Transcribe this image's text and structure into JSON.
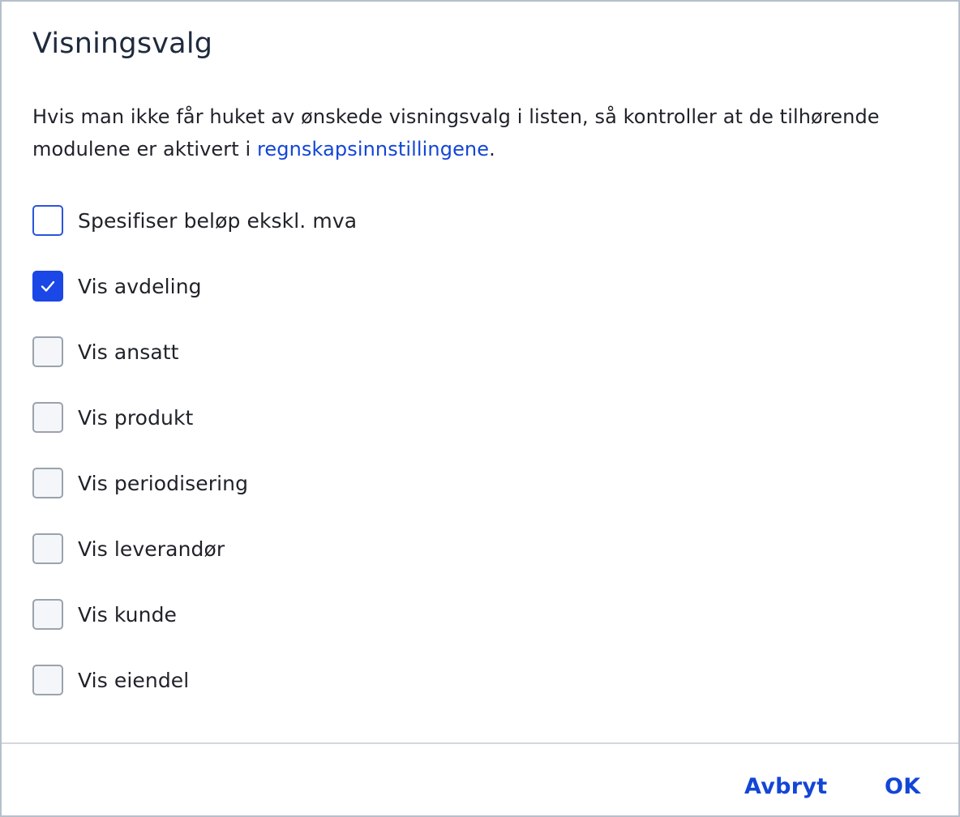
{
  "dialog": {
    "title": "Visningsvalg",
    "intro_text": "Hvis man ikke får huket av ønskede visningsvalg i listen, så kontroller at de tilhørende modulene er aktivert i ",
    "intro_link": "regnskapsinnstillingene",
    "intro_end": ".",
    "options": [
      {
        "label": "Spesifiser beløp ekskl. mva",
        "checked": false,
        "focused": true
      },
      {
        "label": "Vis avdeling",
        "checked": true,
        "focused": false
      },
      {
        "label": "Vis ansatt",
        "checked": false,
        "focused": false
      },
      {
        "label": "Vis produkt",
        "checked": false,
        "focused": false
      },
      {
        "label": "Vis periodisering",
        "checked": false,
        "focused": false
      },
      {
        "label": "Vis leverandør",
        "checked": false,
        "focused": false
      },
      {
        "label": "Vis kunde",
        "checked": false,
        "focused": false
      },
      {
        "label": "Vis eiendel",
        "checked": false,
        "focused": false
      }
    ],
    "cancel_label": "Avbryt",
    "ok_label": "OK"
  },
  "colors": {
    "accent": "#1a47e5",
    "link": "#1346d6",
    "text": "#1f2229",
    "checkbox_border": "#9aa3ad",
    "divider": "#d3d8de"
  },
  "icons": {
    "check": "checkmark-icon"
  }
}
